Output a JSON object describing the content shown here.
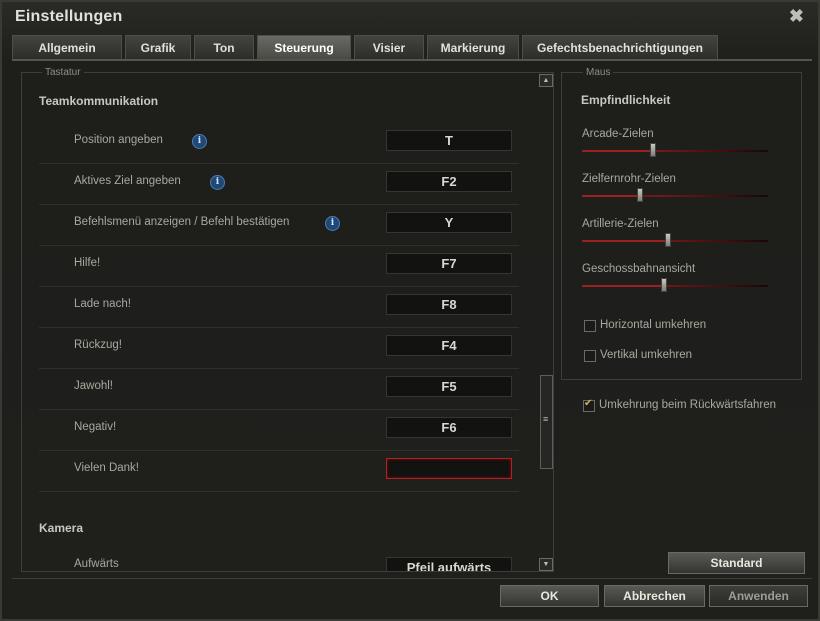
{
  "window": {
    "title": "Einstellungen",
    "close_glyph": "✖"
  },
  "tabs": [
    {
      "label": "Allgemein",
      "active": false
    },
    {
      "label": "Grafik",
      "active": false
    },
    {
      "label": "Ton",
      "active": false
    },
    {
      "label": "Steuerung",
      "active": true
    },
    {
      "label": "Visier",
      "active": false
    },
    {
      "label": "Markierung",
      "active": false
    },
    {
      "label": "Gefechtsbenachrichtigungen",
      "active": false
    }
  ],
  "keyboard": {
    "legend": "Tastatur",
    "section_team": "Teamkommunikation",
    "rows": [
      {
        "label": "Position angeben",
        "key": "T",
        "info": true
      },
      {
        "label": "Aktives Ziel angeben",
        "key": "F2",
        "info": true
      },
      {
        "label": "Befehlsmenü anzeigen / Befehl bestätigen",
        "key": "Y",
        "info": true
      },
      {
        "label": "Hilfe!",
        "key": "F7",
        "info": false
      },
      {
        "label": "Lade nach!",
        "key": "F8",
        "info": false
      },
      {
        "label": "Rückzug!",
        "key": "F4",
        "info": false
      },
      {
        "label": "Jawohl!",
        "key": "F5",
        "info": false
      },
      {
        "label": "Negativ!",
        "key": "F6",
        "info": false
      },
      {
        "label": "Vielen Dank!",
        "key": "",
        "info": false,
        "selected": true
      }
    ],
    "section_camera": "Kamera",
    "camera_rows": [
      {
        "label": "Aufwärts",
        "key": "Pfeil aufwärts"
      }
    ],
    "info_glyph": "i"
  },
  "mouse": {
    "legend": "Maus",
    "section": "Empfindlichkeit",
    "sliders": [
      {
        "label": "Arcade-Zielen",
        "value": 0.38
      },
      {
        "label": "Zielfernrohr-Zielen",
        "value": 0.31
      },
      {
        "label": "Artillerie-Zielen",
        "value": 0.46
      },
      {
        "label": "Geschossbahnansicht",
        "value": 0.44
      }
    ],
    "checkboxes": [
      {
        "label": "Horizontal umkehren",
        "checked": false
      },
      {
        "label": "Vertikal umkehren",
        "checked": false
      }
    ]
  },
  "reverse_driving": {
    "label": "Umkehrung beim Rückwärtsfahren",
    "checked": true
  },
  "buttons": {
    "standard": "Standard",
    "ok": "OK",
    "cancel": "Abbrechen",
    "apply": "Anwenden"
  },
  "scroll": {
    "up_glyph": "▲",
    "down_glyph": "▼",
    "grip_glyph": "≡"
  }
}
